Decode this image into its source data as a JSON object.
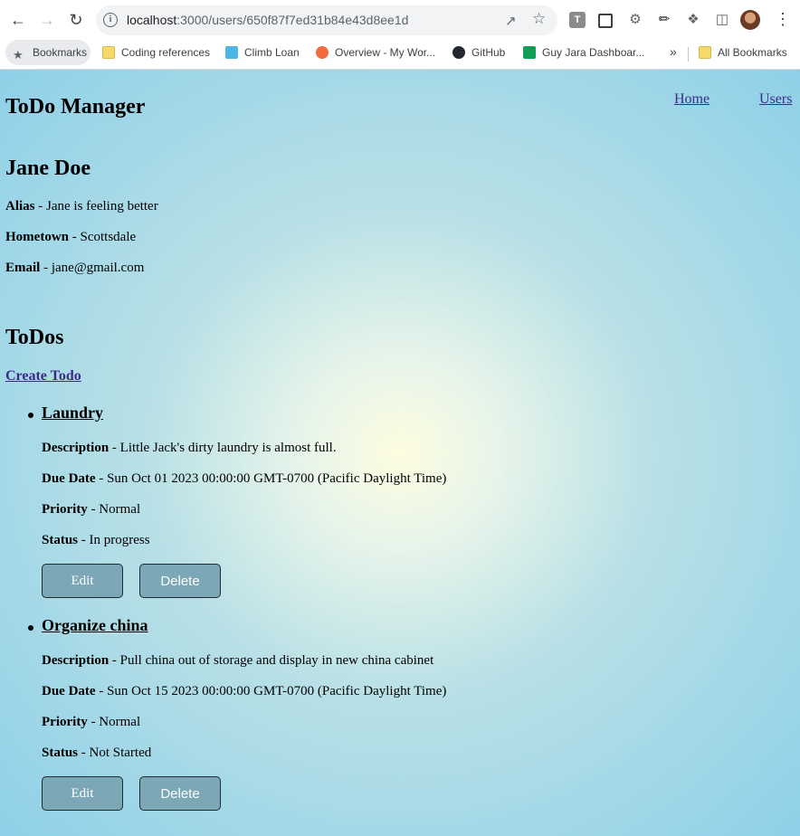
{
  "browser": {
    "url_host": "localhost",
    "url_rest": ":3000/users/650f87f7ed31b84e43d8ee1d",
    "bookmarks": [
      {
        "label": "Bookmarks",
        "icon": "star-icon"
      },
      {
        "label": "Coding references",
        "icon": "folder-icon"
      },
      {
        "label": "Climb Loan",
        "icon": "site-icon"
      },
      {
        "label": "Overview - My Wor...",
        "icon": "site-icon"
      },
      {
        "label": "GitHub",
        "icon": "github-icon"
      },
      {
        "label": "Guy Jara Dashboar...",
        "icon": "sheets-icon"
      }
    ],
    "overflow": "»",
    "all_bookmarks": "All Bookmarks"
  },
  "header": {
    "title": "ToDo Manager",
    "nav": [
      {
        "label": "Home"
      },
      {
        "label": "Users"
      }
    ]
  },
  "user": {
    "name": "Jane Doe",
    "fields": [
      {
        "label": "Alias",
        "value": " - Jane is feeling better"
      },
      {
        "label": "Hometown",
        "value": " - Scottsdale"
      },
      {
        "label": "Email",
        "value": " - jane@gmail.com"
      }
    ]
  },
  "todos": {
    "title": "ToDos",
    "create_label": "Create Todo",
    "items": [
      {
        "title": "Laundry",
        "fields": [
          {
            "label": "Description",
            "value": " - Little Jack's dirty laundry is almost full."
          },
          {
            "label": "Due Date",
            "value": " - Sun Oct 01 2023 00:00:00 GMT-0700 (Pacific Daylight Time)"
          },
          {
            "label": "Priority",
            "value": " - Normal"
          },
          {
            "label": "Status",
            "value": " - In progress"
          }
        ],
        "edit_label": "Edit",
        "delete_label": "Delete"
      },
      {
        "title": "Organize china",
        "fields": [
          {
            "label": "Description",
            "value": " - Pull china out of storage and display in new china cabinet"
          },
          {
            "label": "Due Date",
            "value": " - Sun Oct 15 2023 00:00:00 GMT-0700 (Pacific Daylight Time)"
          },
          {
            "label": "Priority",
            "value": " - Normal"
          },
          {
            "label": "Status",
            "value": " - Not Started"
          }
        ],
        "edit_label": "Edit",
        "delete_label": "Delete"
      }
    ]
  }
}
